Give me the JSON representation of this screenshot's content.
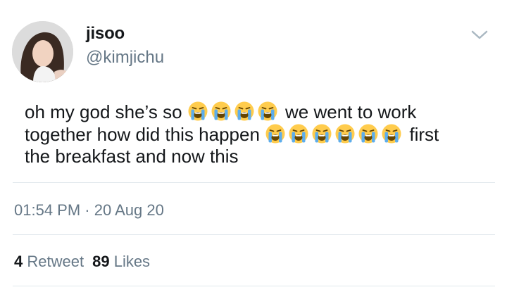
{
  "author": {
    "name": "jisoo",
    "handle": "@kimjichu"
  },
  "tweet": {
    "line1_a": "oh my god she’s so",
    "line1_b": "we went to work",
    "line2_a": "together how did this happen",
    "line2_b": "first",
    "line3": "the breakfast and now this",
    "emoji_name": "loudly-crying-face"
  },
  "meta": {
    "timestamp": "01:54 PM · 20 Aug 20"
  },
  "stats": {
    "retweet_count": "4",
    "retweet_label": "Retweet",
    "likes_count": "89",
    "likes_label": "Likes"
  }
}
